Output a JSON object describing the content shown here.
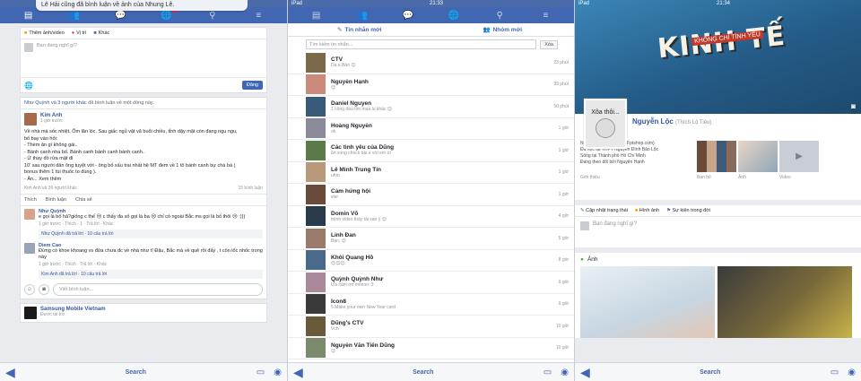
{
  "colors": {
    "fb_blue": "#4267b2",
    "link_blue": "#365899",
    "bg": "#e9ebee"
  },
  "panel1": {
    "notification": "Lê Hải cũng đã bình luận về ảnh của Nhung Lê.",
    "composer": {
      "tabs": [
        "Thêm ảnh/video",
        "Vị trí",
        "Khác"
      ],
      "placeholder": "Bạn đang nghĩ gì?",
      "post_button": "Đăng"
    },
    "feed_note_names": "Như Quỳnh và 3 người khác",
    "feed_note_rest": "đã bình luận về một dòng này.",
    "post": {
      "author": "Kim Anh",
      "time": "1 giờ trước",
      "lines": [
        "Về nhà mà sốc nhiệt. Ốm lăn lóc. Sau giấc ngủ vật vã buổi chiều, tỉnh dậy mặt còn đang ngu ngu,",
        "bố bay vào hỏi:",
        "- Thèm ăn gì không gái..",
        "- Bánh canh nha bố. Bánh canh bánh canh bánh canh..",
        "- Ừ thay đồ rửa mặt đi",
        "10' sau người dân ông tuyệt vời - ông bố xấu trai nhất hệ MT đem về 1 tô bánh canh bự chà bá (",
        "bonus thêm 1 túi thuốc to đùng ).",
        "- Ăn... Xem thêm"
      ],
      "reactions": "Kim Anh và 36 người khác",
      "comments_count": "15 bình luận",
      "actions": [
        "Thích",
        "Bình luận",
        "Chia sẻ"
      ]
    },
    "comments": [
      {
        "name": "Như Quỳnh",
        "text": "e gọi là bố hả?giống c thế 😢 c thấy đa số gọi là ba 😢 chỉ có ngoài Bắc ms gọi là bố thôi 😢 :)))",
        "meta": "1 giờ trước · Thích · 1 · Trả lời · Khác",
        "reply": "Như Quỳnh đã trả lời · 10 câu trả lời"
      },
      {
        "name": "Diem Cao",
        "text": "Đừng có khoe khoang vs đứa chưa đc về nhà như t! Đậu, Bắc mà về quê rồi đấy , t còn lốc nhốc trong này",
        "meta": "1 giờ trước · Thích · Trả lời · Khác",
        "reply": "Kim Anh đã trả lời · 10 câu trả lời"
      }
    ],
    "write_comment_placeholder": "Viết bình luận...",
    "next_post": {
      "author": "Samsung Mobile Vietnam",
      "time": "Được tài trợ"
    }
  },
  "panel2": {
    "status_left": "iPad",
    "status_time": "21:33",
    "tabs": [
      "Tin nhắn mới",
      "Nhóm mới"
    ],
    "search_placeholder": "Tìm kiếm tin nhắn...",
    "search_cancel": "Xóa",
    "conversations": [
      {
        "name": "CTV",
        "snippet": "Dạ a Bảo 😊",
        "time": "23 phút"
      },
      {
        "name": "Nguyễn Hạnh",
        "snippet": "😊",
        "time": "39 phút"
      },
      {
        "name": "Daniel Nguyen",
        "snippet": "1 công đầu tìm mua lu khác 😊",
        "time": "50 phút"
      },
      {
        "name": "Hoàng Nguyễn",
        "snippet": "ok",
        "time": "1 giờ"
      },
      {
        "name": "Các tình yêu của Dũng",
        "snippet": "ăn xong check bài e với em ơi",
        "time": "1 giờ"
      },
      {
        "name": "Lê Minh Trung Tín",
        "snippet": "uhm",
        "time": "1 giờ"
      },
      {
        "name": "Cảm hứng hội",
        "snippet": "vler",
        "time": "1 giờ"
      },
      {
        "name": "Domin Võ",
        "snippet": "mình video thấy tải sao ý 😊",
        "time": "4 giờ"
      },
      {
        "name": "Linh Đan",
        "snippet": "Bạn: 😊",
        "time": "5 giờ"
      },
      {
        "name": "Khôi Quang Hồ",
        "snippet": "😊😊😊",
        "time": "8 giờ"
      },
      {
        "name": "Quỳnh Quỳnh Như",
        "snippet": "Ừa cảm ơn mnnnn :3",
        "time": "9 giờ"
      },
      {
        "name": "Icon8",
        "snippet": "5 Make your own New Year card",
        "time": "9 giờ"
      },
      {
        "name": "Dũng's CTV",
        "snippet": "Vch",
        "time": "10 giờ"
      },
      {
        "name": "Nguyễn Văn Tiến Dũng",
        "snippet": "😊",
        "time": "10 giờ"
      }
    ]
  },
  "panel3": {
    "status_left": "iPad",
    "status_time": "21:34",
    "cover_title": "KINH TẾ",
    "cover_sub": "KHÔNG CHỈ TÌNH YÊU",
    "profile_pic_text": "Xõa thôi...",
    "name": "Nguyễn Lộc",
    "name_sub": "(Thích Lộ Tiều)",
    "intro": [
      "Nhà văn tại FPT Shop (Fptshop.com)",
      "Đã học tại THPT Nguyễn Đình Bảo Lộc",
      "Sống tại Thành phố Hồ Chí Minh",
      "Đang theo dõi bởi Nguyễn Hạnh"
    ],
    "thumb_labels": [
      "Giới thiệu",
      "Bạn bè",
      "Ảnh",
      "Video"
    ],
    "composer_tabs": [
      "Cập nhật trạng thái",
      "Hình ảnh",
      "Sự kiện trong đời"
    ],
    "composer_placeholder": "Bạn đang nghĩ gì?",
    "photos_title": "Ảnh"
  },
  "bottombar": {
    "search": "Search"
  }
}
